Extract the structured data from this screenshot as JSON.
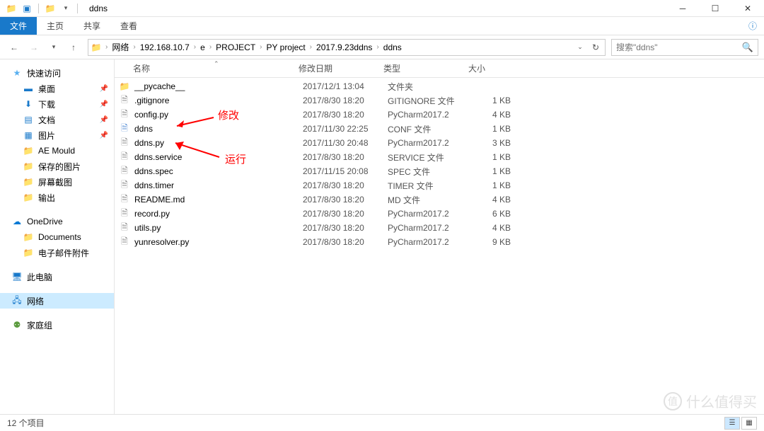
{
  "window": {
    "title": "ddns"
  },
  "ribbon": {
    "file": "文件",
    "home": "主页",
    "share": "共享",
    "view": "查看"
  },
  "breadcrumb": [
    "网络",
    "192.168.10.7",
    "e",
    "PROJECT",
    "PY project",
    "2017.9.23ddns",
    "ddns"
  ],
  "search": {
    "placeholder": "搜索\"ddns\""
  },
  "sidebar": {
    "quick_access": "快速访问",
    "items": [
      {
        "label": "桌面",
        "pinned": true
      },
      {
        "label": "下载",
        "pinned": true
      },
      {
        "label": "文档",
        "pinned": true
      },
      {
        "label": "图片",
        "pinned": true
      },
      {
        "label": "AE Mould",
        "pinned": false
      },
      {
        "label": "保存的图片",
        "pinned": false
      },
      {
        "label": "屏幕截图",
        "pinned": false
      },
      {
        "label": "输出",
        "pinned": false
      }
    ],
    "onedrive": "OneDrive",
    "onedrive_items": [
      {
        "label": "Documents"
      },
      {
        "label": "电子邮件附件"
      }
    ],
    "thispc": "此电脑",
    "network": "网络",
    "homegroup": "家庭组"
  },
  "columns": {
    "name": "名称",
    "date": "修改日期",
    "type": "类型",
    "size": "大小"
  },
  "files": [
    {
      "icon": "folder",
      "name": "__pycache__",
      "date": "2017/12/1 13:04",
      "type": "文件夹",
      "size": ""
    },
    {
      "icon": "file",
      "name": ".gitignore",
      "date": "2017/8/30 18:20",
      "type": "GITIGNORE 文件",
      "size": "1 KB"
    },
    {
      "icon": "py",
      "name": "config.py",
      "date": "2017/8/30 18:20",
      "type": "PyCharm2017.2",
      "size": "4 KB"
    },
    {
      "icon": "conf",
      "name": "ddns",
      "date": "2017/11/30 22:25",
      "type": "CONF 文件",
      "size": "1 KB"
    },
    {
      "icon": "py",
      "name": "ddns.py",
      "date": "2017/11/30 20:48",
      "type": "PyCharm2017.2",
      "size": "3 KB"
    },
    {
      "icon": "file",
      "name": "ddns.service",
      "date": "2017/8/30 18:20",
      "type": "SERVICE 文件",
      "size": "1 KB"
    },
    {
      "icon": "file",
      "name": "ddns.spec",
      "date": "2017/11/15 20:08",
      "type": "SPEC 文件",
      "size": "1 KB"
    },
    {
      "icon": "file",
      "name": "ddns.timer",
      "date": "2017/8/30 18:20",
      "type": "TIMER 文件",
      "size": "1 KB"
    },
    {
      "icon": "file",
      "name": "README.md",
      "date": "2017/8/30 18:20",
      "type": "MD 文件",
      "size": "4 KB"
    },
    {
      "icon": "py",
      "name": "record.py",
      "date": "2017/8/30 18:20",
      "type": "PyCharm2017.2",
      "size": "6 KB"
    },
    {
      "icon": "py",
      "name": "utils.py",
      "date": "2017/8/30 18:20",
      "type": "PyCharm2017.2",
      "size": "4 KB"
    },
    {
      "icon": "py",
      "name": "yunresolver.py",
      "date": "2017/8/30 18:20",
      "type": "PyCharm2017.2",
      "size": "9 KB"
    }
  ],
  "annotations": {
    "modify": "修改",
    "run": "运行"
  },
  "status": {
    "count": "12 个项目"
  },
  "watermark": "什么值得买"
}
